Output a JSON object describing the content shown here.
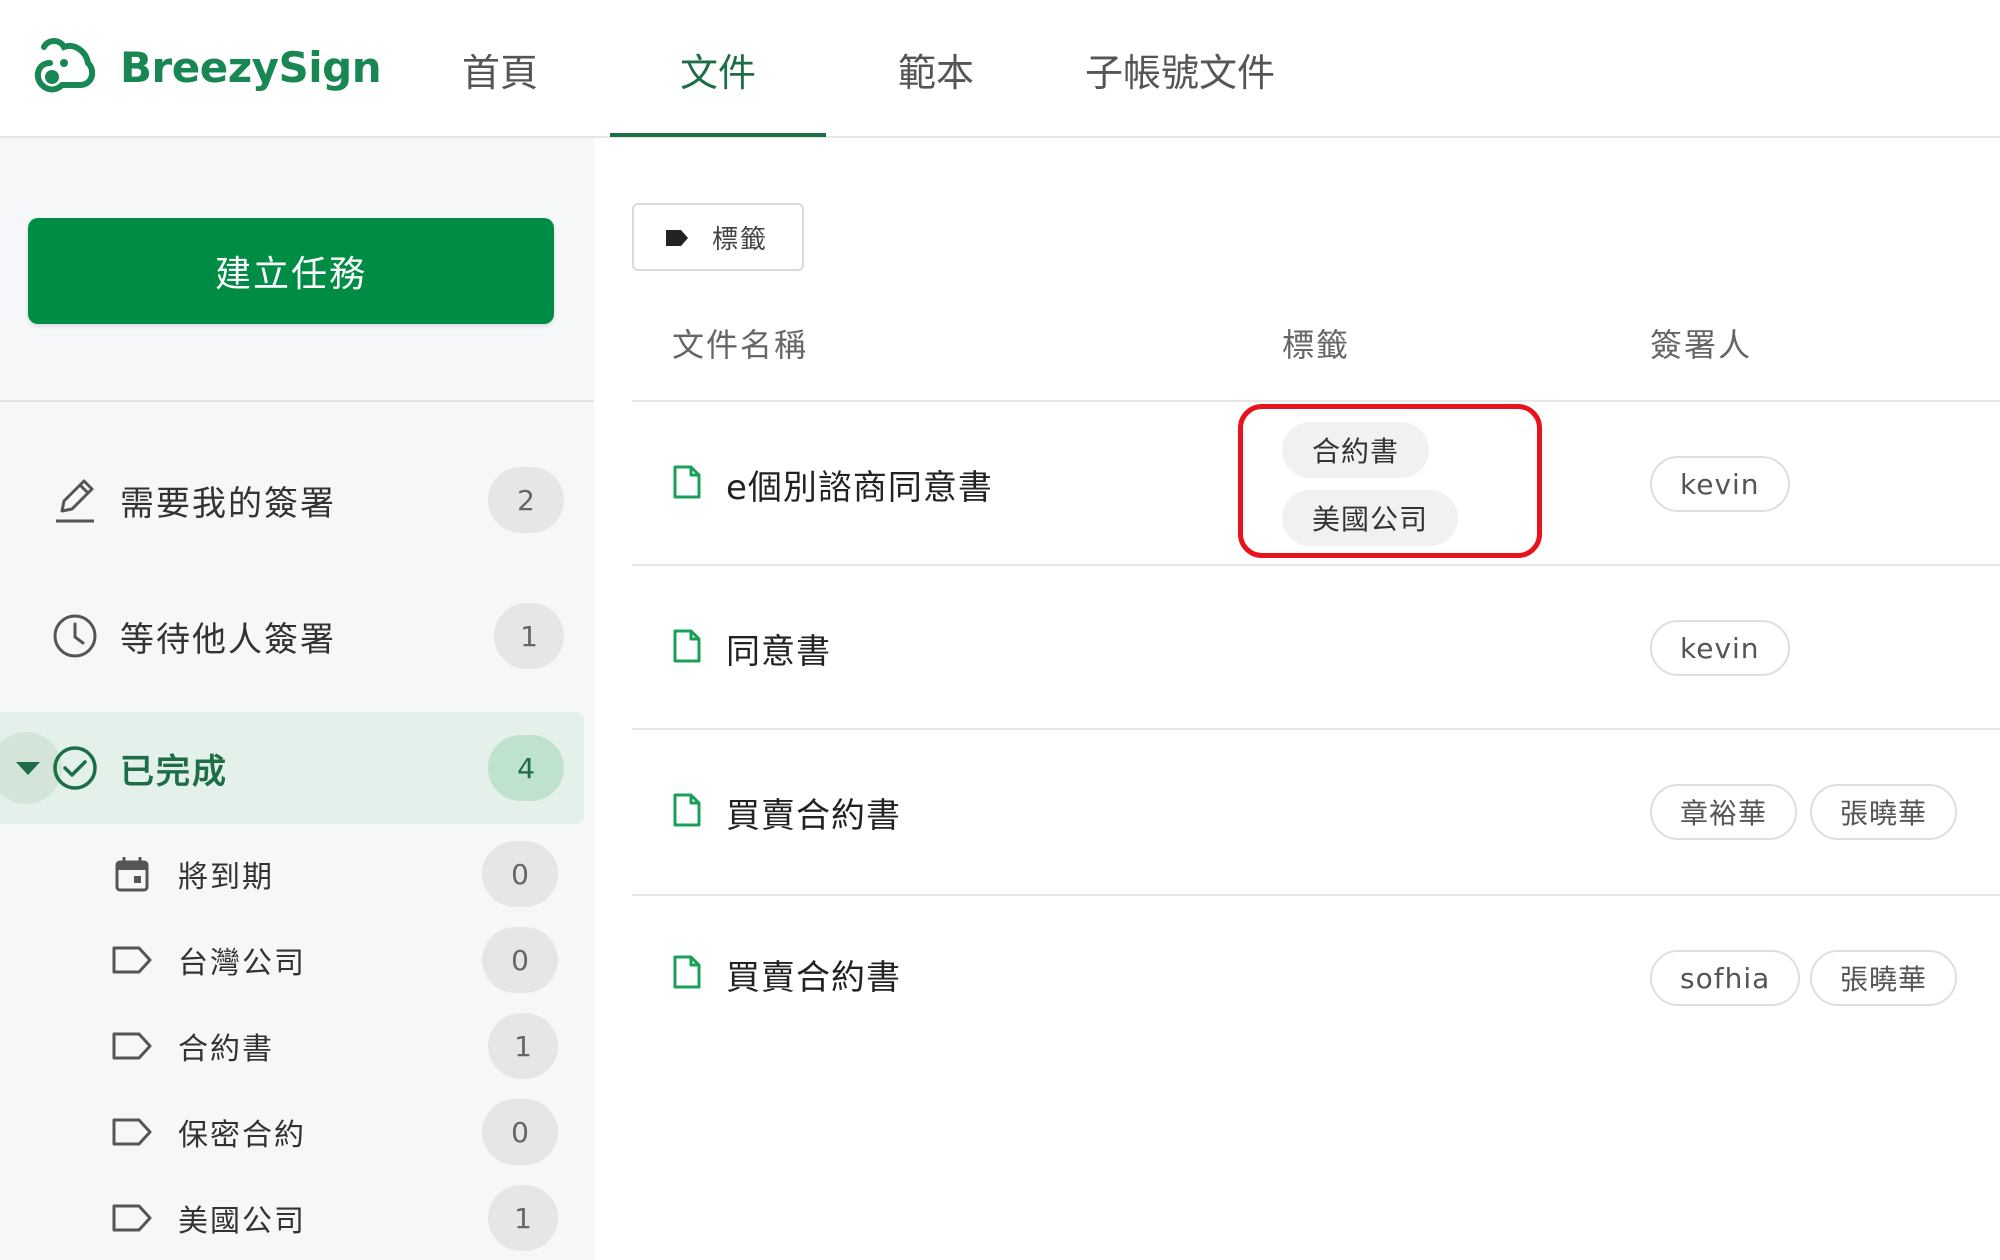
{
  "app": {
    "brand": "BreezySign",
    "brand_color": "#198754",
    "accent_color": "#008c44",
    "highlight_color": "#e8121c"
  },
  "nav": {
    "tabs": [
      {
        "label": "首頁"
      },
      {
        "label": "文件",
        "active": true
      },
      {
        "label": "範本"
      },
      {
        "label": "子帳號文件"
      }
    ]
  },
  "sidebar": {
    "create_button": "建立任務",
    "items": [
      {
        "label": "需要我的簽署",
        "count": "2",
        "icon": "pencil-icon"
      },
      {
        "label": "等待他人簽署",
        "count": "1",
        "icon": "clock-icon"
      },
      {
        "label": "已完成",
        "count": "4",
        "icon": "check-circle-icon",
        "selected": true,
        "expanded": true
      }
    ],
    "sub_items": [
      {
        "label": "將到期",
        "count": "0",
        "icon": "calendar-icon"
      },
      {
        "label": "台灣公司",
        "count": "0",
        "icon": "tag-icon"
      },
      {
        "label": "合約書",
        "count": "1",
        "icon": "tag-icon"
      },
      {
        "label": "保密合約",
        "count": "0",
        "icon": "tag-icon"
      },
      {
        "label": "美國公司",
        "count": "1",
        "icon": "tag-icon"
      }
    ]
  },
  "toolbar": {
    "tag_filter_label": "標籤"
  },
  "table": {
    "headers": [
      "文件名稱",
      "標籤",
      "簽署人"
    ],
    "rows": [
      {
        "name": "e個別諮商同意書",
        "tags": [
          "合約書",
          "美國公司"
        ],
        "signers": [
          "kevin"
        ]
      },
      {
        "name": "同意書",
        "tags": [],
        "signers": [
          "kevin"
        ]
      },
      {
        "name": "買賣合約書",
        "tags": [],
        "signers": [
          "章裕華",
          "張曉華"
        ]
      },
      {
        "name": "買賣合約書",
        "tags": [],
        "signers": [
          "sofhia",
          "張曉華"
        ]
      }
    ]
  }
}
